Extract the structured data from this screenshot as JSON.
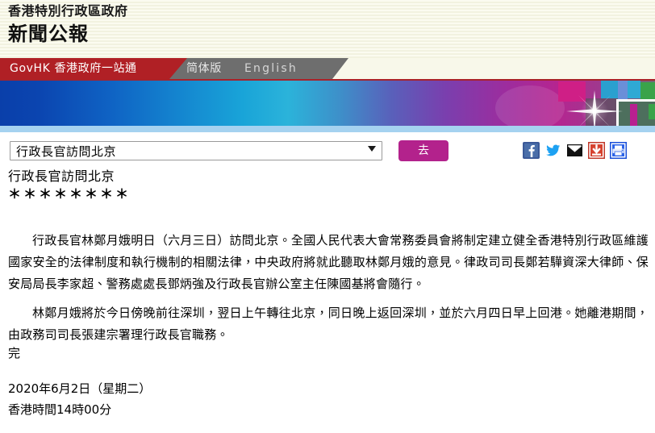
{
  "header": {
    "department": "香港特別行政區政府",
    "title": "新聞公報"
  },
  "nav": {
    "govhk_label": "GovHK 香港政府一站通",
    "simplified_label": "简体版",
    "english_label": "English",
    "red_color": "#b02025",
    "gray_color": "#6e6e6e"
  },
  "banner": {
    "gradient_start": "#0a3faa",
    "gradient_mid": "#19a4d8",
    "gradient_end": "#b52590",
    "underline_color": "#a5d2f0"
  },
  "controls": {
    "topic_select_value": "行政長官訪問北京",
    "topic_select_placeholder": "行政長官訪問北京",
    "go_label": "去",
    "go_color": "#b3228c",
    "icons": [
      {
        "name": "facebook-icon",
        "label": "Facebook",
        "color": "#3b5998"
      },
      {
        "name": "twitter-icon",
        "label": "Twitter",
        "color": "#1da1f2"
      },
      {
        "name": "email-icon",
        "label": "Email",
        "color": "#000000"
      },
      {
        "name": "download-icon",
        "label": "Download",
        "color": "#c0392b"
      },
      {
        "name": "print-icon",
        "label": "Print",
        "color": "#1a4fd8"
      }
    ]
  },
  "article": {
    "title": "行政長官訪問北京",
    "separator": "＊＊＊＊＊＊＊＊",
    "paragraph_1": "行政長官林鄭月娥明日（六月三日）訪問北京。全國人民代表大會常務委員會將制定建立健全香港特別行政區維護國家安全的法律制度和執行機制的相關法律，中央政府將就此聽取林鄭月娥的意見。律政司司長鄭若驊資深大律師、保安局局長李家超、警務處處長鄧炳強及行政長官辦公室主任陳國基將會隨行。",
    "paragraph_2": "林鄭月娥將於今日傍晚前往深圳，翌日上午轉往北京，同日晚上返回深圳，並於六月四日早上回港。她離港期間，由政務司司長張建宗署理行政長官職務。",
    "end_mark": "完",
    "date": "2020年6月2日（星期二）",
    "time": "香港時間14時00分"
  }
}
